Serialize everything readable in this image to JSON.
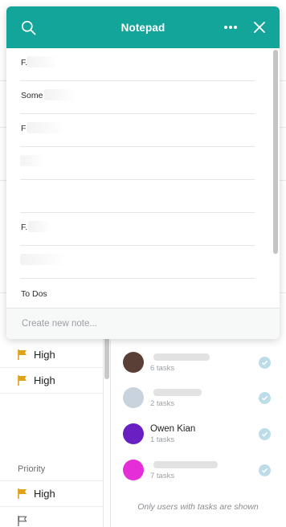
{
  "notepad": {
    "title": "Notepad",
    "notes": [
      {
        "text": "F."
      },
      {
        "text": "Some"
      },
      {
        "text": "F"
      },
      {
        "text": ""
      },
      {
        "text": ""
      },
      {
        "text": "F."
      },
      {
        "text": ""
      },
      {
        "text": "To Dos"
      }
    ],
    "create_placeholder": "Create new note..."
  },
  "priority_column": {
    "rows": [
      {
        "label": "High"
      },
      {
        "label": "High"
      }
    ],
    "label": "Priority",
    "bottom_rows": [
      {
        "label": "High"
      }
    ]
  },
  "users": [
    {
      "name": "",
      "tasks": "6 tasks",
      "avatar_color": "#5a3f36"
    },
    {
      "name": "",
      "tasks": "2 tasks",
      "avatar_color": "#c9d3dd"
    },
    {
      "name": "Owen Kian",
      "tasks": "1 tasks",
      "avatar_color": "#6a1fc2"
    },
    {
      "name": "",
      "tasks": "7 tasks",
      "avatar_color": "#e52ed8"
    }
  ],
  "footer_note": "Only users with tasks are shown",
  "colors": {
    "header": "#14a59a",
    "flag": "#e0a21b",
    "check": "#bcdde8"
  },
  "icons": [
    "search-icon",
    "more-icon",
    "close-icon",
    "flag-icon",
    "check-icon"
  ]
}
